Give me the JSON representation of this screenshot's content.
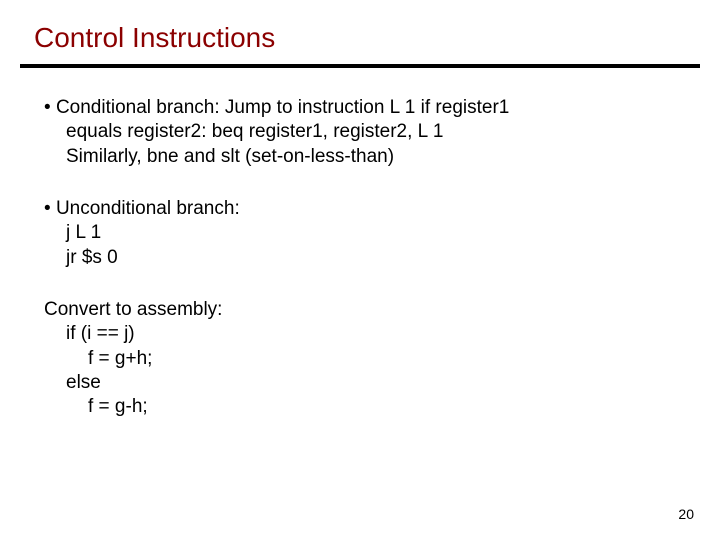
{
  "title": "Control Instructions",
  "bullets": [
    {
      "lines": [
        "Conditional branch: Jump to instruction L 1 if register1",
        "equals register2:        beq    register1,  register2,  L 1",
        "Similarly,  bne  and  slt (set-on-less-than)"
      ]
    },
    {
      "lines": [
        "Unconditional branch:",
        "j     L 1",
        "jr    $s 0"
      ]
    }
  ],
  "convert": {
    "heading": "Convert to assembly:",
    "lines": [
      "if  (i == j)",
      "    f = g+h;",
      "else",
      "    f = g-h;"
    ]
  },
  "page_number": "20",
  "bullet_char": "•"
}
